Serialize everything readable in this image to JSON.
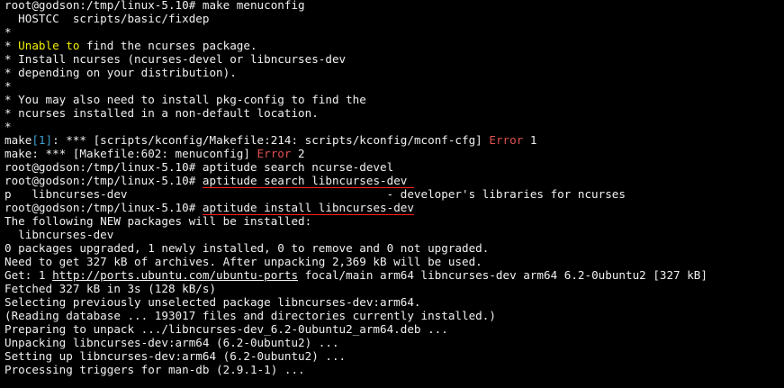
{
  "colors": {
    "background": "#000000",
    "text": "#f0f0f0",
    "yellow": "#f0f000",
    "red": "#e05050",
    "cyan": "#40a0d0",
    "underline": "#ff2020"
  },
  "lines": [
    {
      "segments": [
        {
          "text": "root@godson:/tmp/linux-5.10# make menuconfig"
        }
      ]
    },
    {
      "segments": [
        {
          "text": "  HOSTCC  scripts/basic/fixdep"
        }
      ]
    },
    {
      "segments": [
        {
          "text": "*"
        }
      ]
    },
    {
      "segments": [
        {
          "text": "* "
        },
        {
          "text": "Unable to",
          "color": "yellow"
        },
        {
          "text": " find the ncurses package."
        }
      ]
    },
    {
      "segments": [
        {
          "text": "* Install ncurses (ncurses-devel or libncurses-dev"
        }
      ]
    },
    {
      "segments": [
        {
          "text": "* depending on your distribution)."
        }
      ]
    },
    {
      "segments": [
        {
          "text": "*"
        }
      ]
    },
    {
      "segments": [
        {
          "text": "* You may also need to install pkg-config to find the"
        }
      ]
    },
    {
      "segments": [
        {
          "text": "* ncurses installed in a non-default location."
        }
      ]
    },
    {
      "segments": [
        {
          "text": "*"
        }
      ]
    },
    {
      "segments": [
        {
          "text": "make"
        },
        {
          "text": "[1]",
          "color": "cyan"
        },
        {
          "text": ": *** [scripts/kconfig/Makefile:214: scripts/kconfig/mconf-cfg] "
        },
        {
          "text": "Error",
          "color": "red"
        },
        {
          "text": " 1"
        }
      ]
    },
    {
      "segments": [
        {
          "text": "make: *** [Makefile:602: menuconfig] "
        },
        {
          "text": "Error",
          "color": "red"
        },
        {
          "text": " 2"
        }
      ]
    },
    {
      "segments": [
        {
          "text": "root@godson:/tmp/linux-5.10# aptitude search ncurse-devel"
        }
      ]
    },
    {
      "segments": [
        {
          "text": "root@godson:/tmp/linux-5.10# "
        },
        {
          "text": "aptitude search libncurses-dev ",
          "style": "cmd"
        }
      ]
    },
    {
      "segments": [
        {
          "text": "p   libncurses-dev                                      - developer's libraries for ncurses"
        }
      ]
    },
    {
      "segments": [
        {
          "text": "root@godson:/tmp/linux-5.10# "
        },
        {
          "text": "aptitude install libncurses-dev",
          "style": "cmd"
        }
      ]
    },
    {
      "segments": [
        {
          "text": "The following NEW packages will be installed:"
        }
      ]
    },
    {
      "segments": [
        {
          "text": "  libncurses-dev"
        }
      ]
    },
    {
      "segments": [
        {
          "text": "0 packages upgraded, 1 newly installed, 0 to remove and 0 not upgraded."
        }
      ]
    },
    {
      "segments": [
        {
          "text": "Need to get 327 kB of archives. After unpacking 2,369 kB will be used."
        }
      ]
    },
    {
      "segments": [
        {
          "text": "Get: 1 "
        },
        {
          "text": "http://ports.ubuntu.com/ubuntu-ports",
          "style": "link"
        },
        {
          "text": " focal/main arm64 libncurses-dev arm64 6.2-0ubuntu2 [327 kB]"
        }
      ]
    },
    {
      "segments": [
        {
          "text": "Fetched 327 kB in 3s (128 kB/s)"
        }
      ]
    },
    {
      "segments": [
        {
          "text": "Selecting previously unselected package libncurses-dev:arm64."
        }
      ]
    },
    {
      "segments": [
        {
          "text": "(Reading database ... 193017 files and directories currently installed.)"
        }
      ]
    },
    {
      "segments": [
        {
          "text": "Preparing to unpack .../libncurses-dev_6.2-0ubuntu2_arm64.deb ..."
        }
      ]
    },
    {
      "segments": [
        {
          "text": "Unpacking libncurses-dev:arm64 (6.2-0ubuntu2) ..."
        }
      ]
    },
    {
      "segments": [
        {
          "text": "Setting up libncurses-dev:arm64 (6.2-0ubuntu2) ..."
        }
      ]
    },
    {
      "segments": [
        {
          "text": "Processing triggers for man-db (2.9.1-1) ..."
        }
      ]
    }
  ]
}
